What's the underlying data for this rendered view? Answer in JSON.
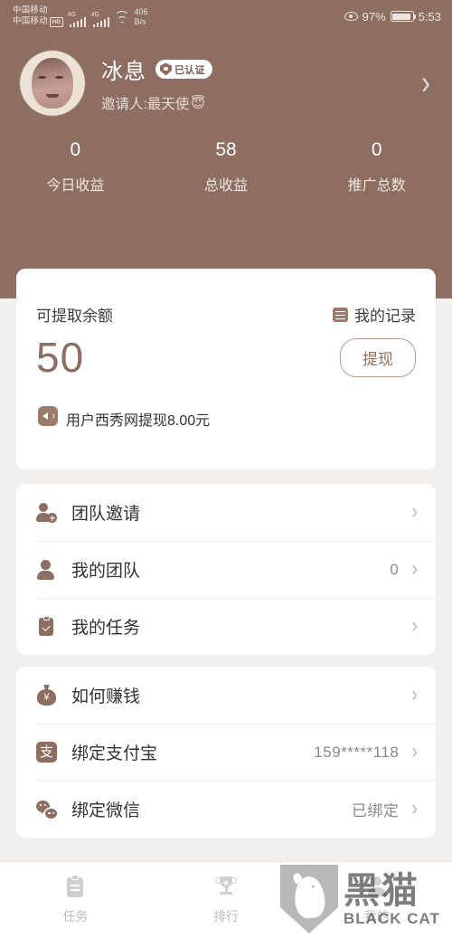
{
  "status_bar": {
    "carrier_line1": "中国移动",
    "carrier_line2": "中国移动",
    "hd_badge": "HD",
    "network_type_1": "4G",
    "network_type_2": "4G",
    "net_speed_value": "406",
    "net_speed_unit": "B/s",
    "battery_percent": "97%",
    "clock": "5:53"
  },
  "profile": {
    "name": "冰息",
    "verified_label": "已认证",
    "inviter": "邀请人:最天使",
    "inviter_emoji": "😇"
  },
  "stats": [
    {
      "value": "0",
      "label": "今日收益"
    },
    {
      "value": "58",
      "label": "总收益"
    },
    {
      "value": "0",
      "label": "推广总数"
    }
  ],
  "balance_card": {
    "label": "可提取余额",
    "amount": "50",
    "record_link": "我的记录",
    "withdraw_button": "提现",
    "marquee": "用户西秀网提现8.00元"
  },
  "menu_group_1": [
    {
      "label": "团队邀请",
      "value": ""
    },
    {
      "label": "我的团队",
      "value": "0"
    },
    {
      "label": "我的任务",
      "value": ""
    }
  ],
  "menu_group_2": [
    {
      "label": "如何赚钱",
      "value": ""
    },
    {
      "label": "绑定支付宝",
      "value": "159*****118"
    },
    {
      "label": "绑定微信",
      "value": "已绑定"
    }
  ],
  "alipay_glyph": "支",
  "tabs": [
    {
      "label": "任务"
    },
    {
      "label": "排行"
    },
    {
      "label": "我的"
    }
  ],
  "watermark": {
    "cn": "黑猫",
    "en": "BLACK CAT"
  },
  "colors": {
    "brand_brown": "#8d6e60",
    "page_bg": "#f1f0ee",
    "card_bg": "#ffffff",
    "muted_text": "#8a8a8a"
  }
}
